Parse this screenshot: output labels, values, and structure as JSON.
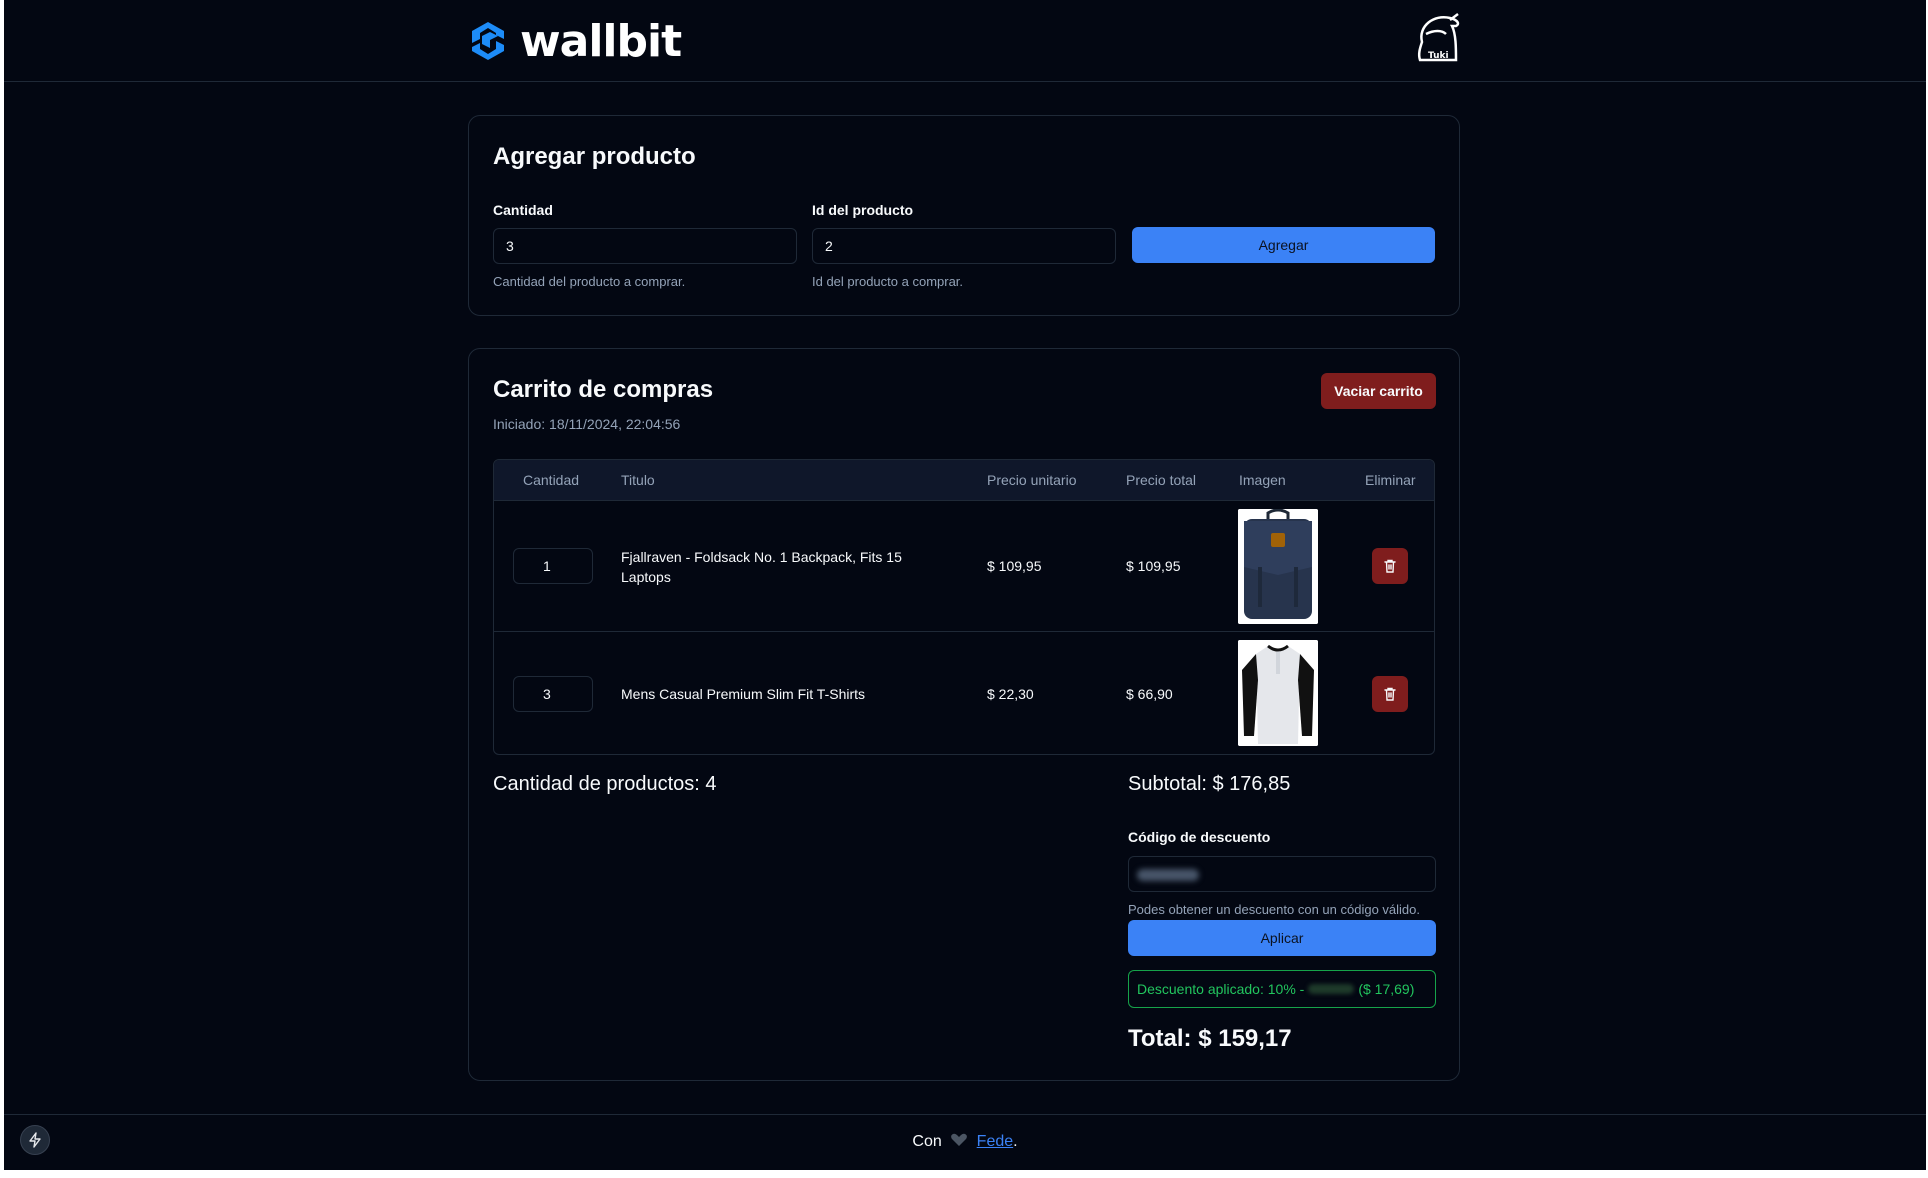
{
  "brand": {
    "name": "wallbit",
    "color": "#1d8cf8"
  },
  "add_product": {
    "title": "Agregar producto",
    "quantity": {
      "label": "Cantidad",
      "value": "3",
      "help": "Cantidad del producto a comprar."
    },
    "product_id": {
      "label": "Id del producto",
      "value": "2",
      "help": "Id del producto a comprar."
    },
    "submit_label": "Agregar"
  },
  "cart": {
    "title": "Carrito de compras",
    "started": "Iniciado: 18/11/2024, 22:04:56",
    "clear_label": "Vaciar carrito",
    "columns": [
      "Cantidad",
      "Titulo",
      "Precio unitario",
      "Precio total",
      "Imagen",
      "Eliminar"
    ],
    "items": [
      {
        "quantity": "1",
        "title": "Fjallraven - Foldsack No. 1 Backpack, Fits 15 Laptops",
        "unit_price": "$ 109,95",
        "total_price": "$ 109,95",
        "image": "backpack-image"
      },
      {
        "quantity": "3",
        "title": "Mens Casual Premium Slim Fit T-Shirts",
        "unit_price": "$ 22,30",
        "total_price": "$ 66,90",
        "image": "tshirt-image"
      }
    ],
    "product_count": "Cantidad de productos: 4",
    "subtotal": "Subtotal: $ 176,85",
    "discount": {
      "label": "Código de descuento",
      "help": "Podes obtener un descuento con un código válido.",
      "apply_label": "Aplicar",
      "applied_prefix": "Descuento aplicado: 10% -",
      "applied_amount": "($ 17,69)"
    },
    "total": "Total: $ 159,17"
  },
  "footer": {
    "prefix": "Con",
    "author": "Fede",
    "suffix": "."
  },
  "colors": {
    "background": "#030712",
    "primary": "#3b82f6",
    "danger": "#7f1d1d",
    "success": "#22c55e"
  }
}
